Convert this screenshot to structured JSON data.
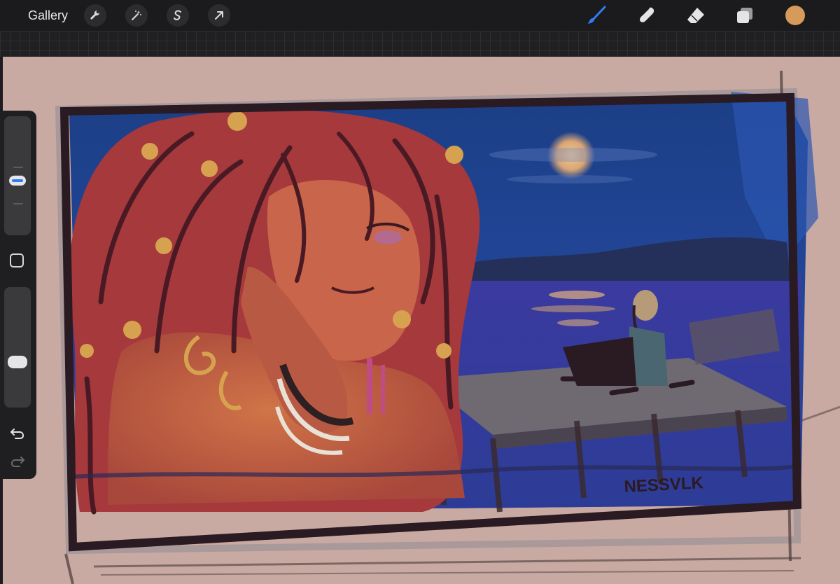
{
  "toolbar": {
    "gallery_label": "Gallery",
    "actions": [
      {
        "name": "actions",
        "icon": "wrench-icon"
      },
      {
        "name": "adjustments",
        "icon": "magic-wand-icon"
      },
      {
        "name": "selection",
        "icon": "selection-s-icon"
      },
      {
        "name": "transform",
        "icon": "arrow-cursor-icon"
      }
    ],
    "tools": [
      {
        "name": "brush",
        "icon": "brush-icon",
        "active": true
      },
      {
        "name": "smudge",
        "icon": "smudge-finger-icon",
        "active": false
      },
      {
        "name": "eraser",
        "icon": "eraser-icon",
        "active": false
      },
      {
        "name": "layers",
        "icon": "layers-icon",
        "active": false
      }
    ],
    "active_color": "#d69a5b",
    "accent_color": "#2f7cf6"
  },
  "sidebar": {
    "brush_size_level": 0.45,
    "opacity_level": 0.35,
    "undo_icon": "undo-arrow-icon",
    "redo_icon": "redo-arrow-icon",
    "modify_icon": "square-modify-icon"
  },
  "artwork": {
    "signature": "NESSVLK"
  }
}
